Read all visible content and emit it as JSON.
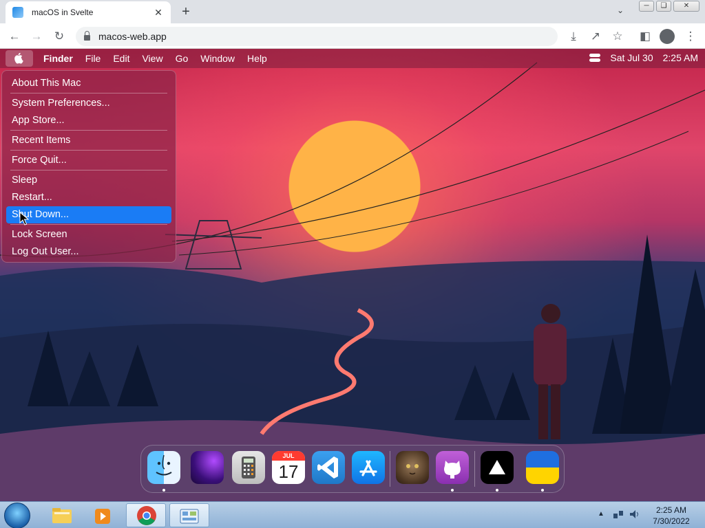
{
  "browser": {
    "tab_title": "macOS in Svelte",
    "tab_close": "✕",
    "new_tab": "+",
    "url": "macos-web.app"
  },
  "macos": {
    "menubar": {
      "items": [
        "Finder",
        "File",
        "Edit",
        "View",
        "Go",
        "Window",
        "Help"
      ],
      "date": "Sat Jul 30",
      "time": "2:25 AM"
    },
    "apple_menu": {
      "items": [
        "About This Mac",
        "System Preferences...",
        "App Store...",
        "Recent Items",
        "Force Quit...",
        "Sleep",
        "Restart...",
        "Shut Down...",
        "Lock Screen",
        "Log Out User..."
      ],
      "highlighted": "Shut Down..."
    },
    "dock": {
      "apps": [
        "Finder",
        "Wallpapers",
        "Calculator",
        "Calendar",
        "VS Code",
        "App Store",
        "Purrfect Cat",
        "GitHub",
        "Vercel",
        "Ukraine"
      ],
      "calendar_month": "JUL",
      "calendar_day": "17"
    }
  },
  "taskbar": {
    "clock_time": "2:25 AM",
    "clock_date": "7/30/2022"
  }
}
